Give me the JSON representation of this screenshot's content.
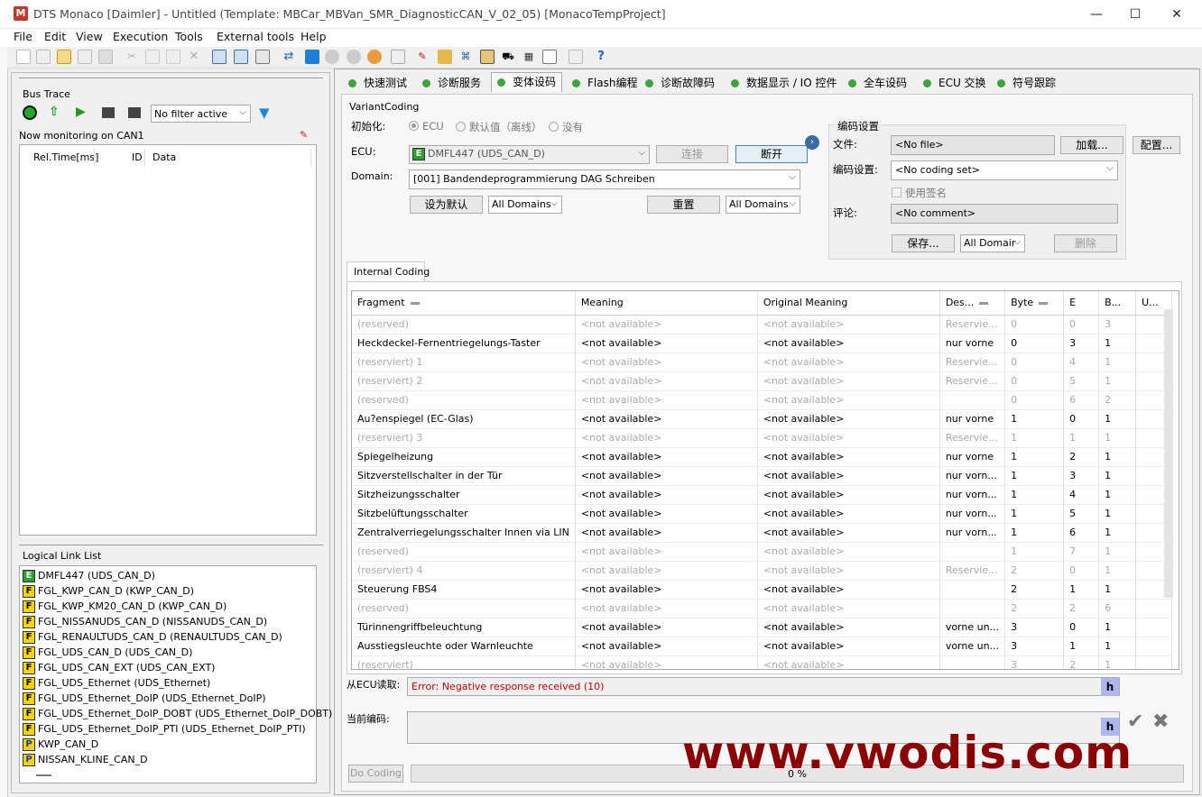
{
  "window": {
    "title": "DTS Monaco [Daimler] - Untitled (Template: MBCar_MBVan_SMR_DiagnosticCAN_V_02_05) [MonacoTempProject]",
    "icon_letter": "M",
    "min": "—",
    "max": "☐",
    "close": "✕"
  },
  "menu": [
    "File",
    "Edit",
    "View",
    "Execution",
    "Tools",
    "External tools",
    "Help"
  ],
  "left": {
    "bus_trace_title": "Bus Trace",
    "filter_value": "No filter active",
    "monitoring": "Now monitoring on CAN1",
    "columns": [
      "Rel.Time[ms]",
      "ID",
      "Data"
    ],
    "logical_link_title": "Logical Link List",
    "links": [
      {
        "type": "E",
        "label": "DMFL447 (UDS_CAN_D)"
      },
      {
        "type": "F",
        "label": "FGL_KWP_CAN_D (KWP_CAN_D)"
      },
      {
        "type": "F",
        "label": "FGL_KWP_KM20_CAN_D (KWP_CAN_D)"
      },
      {
        "type": "F",
        "label": "FGL_NISSANUDS_CAN_D (NISSANUDS_CAN_D)"
      },
      {
        "type": "F",
        "label": "FGL_RENAULTUDS_CAN_D (RENAULTUDS_CAN_D)"
      },
      {
        "type": "F",
        "label": "FGL_UDS_CAN_D (UDS_CAN_D)"
      },
      {
        "type": "F",
        "label": "FGL_UDS_CAN_EXT (UDS_CAN_EXT)"
      },
      {
        "type": "F",
        "label": "FGL_UDS_Ethernet (UDS_Ethernet)"
      },
      {
        "type": "F",
        "label": "FGL_UDS_Ethernet_DoIP (UDS_Ethernet_DoIP)"
      },
      {
        "type": "F",
        "label": "FGL_UDS_Ethernet_DoIP_DOBT (UDS_Ethernet_DoIP_DOBT)"
      },
      {
        "type": "F",
        "label": "FGL_UDS_Ethernet_DoIP_PTI (UDS_Ethernet_DoIP_PTI)"
      },
      {
        "type": "P",
        "label": "KWP_CAN_D"
      },
      {
        "type": "P",
        "label": "NISSAN_KLINE_CAN_D"
      }
    ]
  },
  "tabs": [
    "快速测试",
    "诊断服务",
    "变体设码",
    "Flash编程",
    "诊断故障码",
    "数据显示 / IO 控件",
    "全车设码",
    "ECU 交换",
    "符号跟踪"
  ],
  "active_tab": "变体设码",
  "vc": {
    "group_title": "VariantCoding",
    "init_label": "初始化:",
    "init_options": [
      "ECU",
      "默认值（离线）",
      "没有"
    ],
    "ecu_label": "ECU:",
    "ecu_value": "DMFL447 (UDS_CAN_D)",
    "connect": "连接",
    "disconnect": "断开",
    "domain_label": "Domain:",
    "domain_value": "[001] Bandendeprogrammierung DAG Schreiben",
    "set_default": "设为默认",
    "all_domains_1": "All Domains",
    "reset": "重置",
    "all_domains_2": "All Domains",
    "coding_settings": {
      "title": "编码设置",
      "file_label": "文件:",
      "file_value": "<No file>",
      "load": "加载...",
      "config": "配置...",
      "coding_label": "编码设置:",
      "coding_value": "<No coding set>",
      "use_signature": "使用签名",
      "comment_label": "评论:",
      "comment_value": "<No comment>",
      "save": "保存...",
      "all_domain": "All Domair",
      "delete": "删除"
    },
    "inner_tab": "Internal Coding",
    "table": {
      "headers": [
        "Fragment",
        "Meaning",
        "Original Meaning",
        "Des...",
        "Byte",
        "E",
        "B...",
        "U..."
      ],
      "rows": [
        {
          "gray": true,
          "cells": [
            "(reserved)",
            "<not available>",
            "<not available>",
            "Reservie...",
            "0",
            "0",
            "3",
            ""
          ]
        },
        {
          "gray": false,
          "cells": [
            "Heckdeckel-Fernentriegelungs-Taster",
            "<not available>",
            "<not available>",
            "nur vorne",
            "0",
            "3",
            "1",
            ""
          ]
        },
        {
          "gray": true,
          "cells": [
            "(reserviert) 1",
            "<not available>",
            "<not available>",
            "Reservie...",
            "0",
            "4",
            "1",
            ""
          ]
        },
        {
          "gray": true,
          "cells": [
            "(reserviert) 2",
            "<not available>",
            "<not available>",
            "Reservie...",
            "0",
            "5",
            "1",
            ""
          ]
        },
        {
          "gray": true,
          "cells": [
            "(reserved)",
            "<not available>",
            "<not available>",
            "",
            "0",
            "6",
            "2",
            ""
          ]
        },
        {
          "gray": false,
          "cells": [
            "Au?enspiegel (EC-Glas)",
            "<not available>",
            "<not available>",
            "nur vorne",
            "1",
            "0",
            "1",
            ""
          ]
        },
        {
          "gray": true,
          "cells": [
            "(reserviert) 3",
            "<not available>",
            "<not available>",
            "Reservie...",
            "1",
            "1",
            "1",
            ""
          ]
        },
        {
          "gray": false,
          "cells": [
            "Spiegelheizung",
            "<not available>",
            "<not available>",
            "nur vorne",
            "1",
            "2",
            "1",
            ""
          ]
        },
        {
          "gray": false,
          "cells": [
            "Sitzverstellschalter in der Tür",
            "<not available>",
            "<not available>",
            "nur vorn...",
            "1",
            "3",
            "1",
            ""
          ]
        },
        {
          "gray": false,
          "cells": [
            "Sitzheizungsschalter",
            "<not available>",
            "<not available>",
            "nur vorn...",
            "1",
            "4",
            "1",
            ""
          ]
        },
        {
          "gray": false,
          "cells": [
            "Sitzbelüftungsschalter",
            "<not available>",
            "<not available>",
            "nur vorn...",
            "1",
            "5",
            "1",
            ""
          ]
        },
        {
          "gray": false,
          "cells": [
            "Zentralverriegelungsschalter Innen via LIN",
            "<not available>",
            "<not available>",
            "nur vorn...",
            "1",
            "6",
            "1",
            ""
          ]
        },
        {
          "gray": true,
          "cells": [
            "(reserved)",
            "<not available>",
            "<not available>",
            "",
            "1",
            "7",
            "1",
            ""
          ]
        },
        {
          "gray": true,
          "cells": [
            "(reserviert) 4",
            "<not available>",
            "<not available>",
            "Reservie...",
            "2",
            "0",
            "1",
            ""
          ]
        },
        {
          "gray": false,
          "cells": [
            "Steuerung FBS4",
            "<not available>",
            "<not available>",
            "",
            "2",
            "1",
            "1",
            ""
          ]
        },
        {
          "gray": true,
          "cells": [
            "(reserved)",
            "<not available>",
            "<not available>",
            "",
            "2",
            "2",
            "6",
            ""
          ]
        },
        {
          "gray": false,
          "cells": [
            "Türinnengriffbeleuchtung",
            "<not available>",
            "<not available>",
            "vorne un...",
            "3",
            "0",
            "1",
            ""
          ]
        },
        {
          "gray": false,
          "cells": [
            "Ausstiegsleuchte oder Warnleuchte",
            "<not available>",
            "<not available>",
            "vorne un...",
            "3",
            "1",
            "1",
            ""
          ]
        },
        {
          "gray": true,
          "cells": [
            "(reserviert)",
            "<not available>",
            "<not available>",
            "",
            "3",
            "2",
            "1",
            ""
          ]
        }
      ]
    },
    "read_label": "从ECU读取:",
    "read_value": "Error: Negative response received (10)",
    "h": "h",
    "current_label": "当前编码:",
    "do_coding": "Do Coding",
    "progress_text": "0 %",
    "progress_value": 0
  },
  "watermark": "www.vwodis.com",
  "colors": {
    "error": "#cc0000",
    "watermark": "#8b0000",
    "active_dot": "#3aa53a"
  }
}
